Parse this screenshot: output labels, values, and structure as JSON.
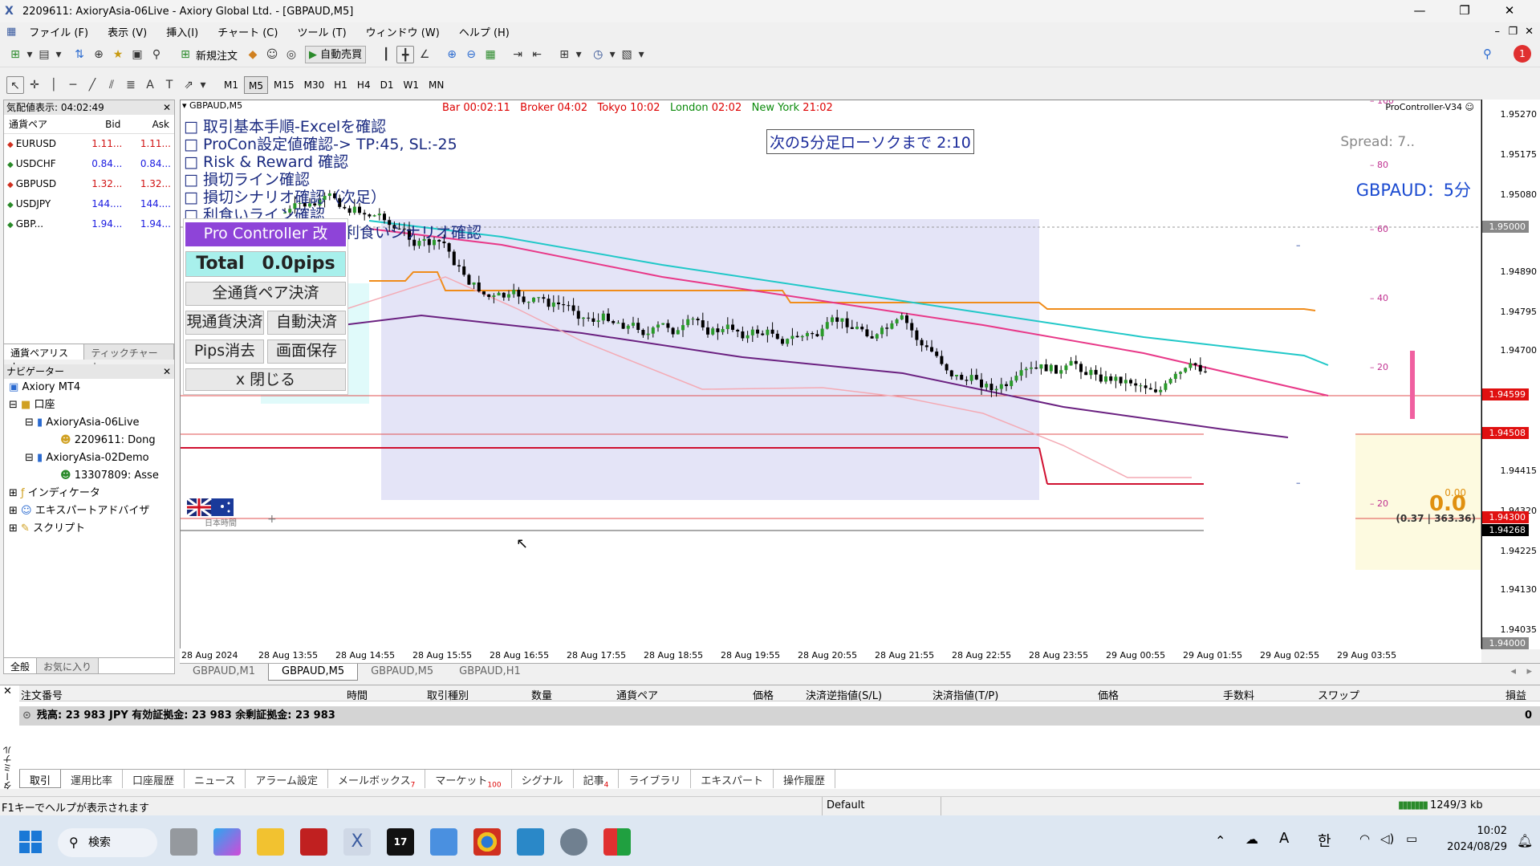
{
  "window": {
    "title": "2209611: AxioryAsia-06Live - Axiory Global Ltd. - [GBPAUD,M5]",
    "icon": "app-icon"
  },
  "menu": [
    "ファイル (F)",
    "表示 (V)",
    "挿入(I)",
    "チャート (C)",
    "ツール (T)",
    "ウィンドウ (W)",
    "ヘルプ (H)"
  ],
  "toolbar": {
    "new_order": "新規注文",
    "auto_trade": "自動売買",
    "timeframes": [
      "M1",
      "M5",
      "M15",
      "M30",
      "H1",
      "H4",
      "D1",
      "W1",
      "MN"
    ],
    "active_tf": "M5"
  },
  "market_watch": {
    "header": "気配値表示: 04:02:49",
    "columns": [
      "通貨ペア",
      "Bid",
      "Ask"
    ],
    "rows": [
      {
        "symbol": "EURUSD",
        "bid": "1.11...",
        "ask": "1.11...",
        "dir": "down"
      },
      {
        "symbol": "USDCHF",
        "bid": "0.84...",
        "ask": "0.84...",
        "dir": "up"
      },
      {
        "symbol": "GBPUSD",
        "bid": "1.32...",
        "ask": "1.32...",
        "dir": "down"
      },
      {
        "symbol": "USDJPY",
        "bid": "144....",
        "ask": "144....",
        "dir": "up"
      },
      {
        "symbol": "GBP...",
        "bid": "1.94...",
        "ask": "1.94...",
        "dir": "up"
      }
    ],
    "tabs": [
      "通貨ペアリスト",
      "ティックチャート"
    ]
  },
  "navigator": {
    "header": "ナビゲーター",
    "items": [
      "Axiory MT4",
      "口座",
      "AxioryAsia-06Live",
      "2209611: Dong",
      "AxioryAsia-02Demo",
      "13307809: Asse",
      "インディケータ",
      "エキスパートアドバイザ",
      "スクリプト"
    ],
    "tabs": [
      "全般",
      "お気に入り"
    ]
  },
  "chart": {
    "symbol_label": "GBPAUD,M5",
    "bar": "Bar",
    "bar_time": "00:02:11",
    "broker": "Broker",
    "broker_time": "04:02",
    "tokyo": "Tokyo",
    "tokyo_time": "10:02",
    "london": "London",
    "london_time": "02:02",
    "newyork": "New York",
    "newyork_time": "21:02",
    "checklist": [
      "□ 取引基本手順-Excelを確認",
      "□ ProCon設定値確認-> TP:45, SL:-25",
      "□ Risk & Reward 確認",
      "□ 損切ライン確認",
      "□ 損切シナリオ確認（次足）",
      "□ 利食いライン確認",
      "□ 利食いシナリオ確認"
    ],
    "countdown": "次の5分足ローソクまで 2:10",
    "indicator": "ProController-V34 ☺",
    "spread": "Spread: 7..",
    "pair_tf": "GBPAUD：5分",
    "scale_levels": [
      "100",
      "80",
      "60",
      "40",
      "20",
      "20"
    ],
    "profit": "0.0",
    "profit_small": "0.00",
    "ratio": "(0.37 | 363.36)",
    "flag_label": "日本時間"
  },
  "procon": {
    "title": "Pro Controller 改",
    "total": "Total　0.0pips",
    "close_all": "全通貨ペア決済",
    "close_current": "現通貨決済",
    "auto_close": "自動決済",
    "clear_pips": "Pips消去",
    "save_screen": "画面保存",
    "close": "x 閉じる"
  },
  "price_axis": {
    "labels": [
      "1.95270",
      "1.95175",
      "1.95080",
      "1.94890",
      "1.94795",
      "1.94700",
      "1.94415",
      "1.94320",
      "1.94225",
      "1.94130",
      "1.94035"
    ],
    "tags": [
      {
        "v": "1.95000",
        "c": "#777777"
      },
      {
        "v": "1.94599",
        "c": "#e01010"
      },
      {
        "v": "1.94508",
        "c": "#e01010"
      },
      {
        "v": "1.94300",
        "c": "#e01010"
      },
      {
        "v": "1.94268",
        "c": "#000000"
      },
      {
        "v": "1.94000",
        "c": "#777777"
      }
    ]
  },
  "time_axis": [
    "28 Aug 2024",
    "28 Aug 13:55",
    "28 Aug 14:55",
    "28 Aug 15:55",
    "28 Aug 16:55",
    "28 Aug 17:55",
    "28 Aug 18:55",
    "28 Aug 19:55",
    "28 Aug 20:55",
    "28 Aug 21:55",
    "28 Aug 22:55",
    "28 Aug 23:55",
    "29 Aug 00:55",
    "29 Aug 01:55",
    "29 Aug 02:55",
    "29 Aug 03:55"
  ],
  "chart_tabs": [
    "GBPAUD,M1",
    "GBPAUD,M5",
    "GBPAUD,M5",
    "GBPAUD,H1"
  ],
  "terminal": {
    "columns": [
      "注文番号",
      "時間",
      "取引種別",
      "数量",
      "通貨ペア",
      "価格",
      "決済逆指値(S/L)",
      "決済指値(T/P)",
      "価格",
      "手数料",
      "スワップ",
      "損益"
    ],
    "balance": "残高: 23 983 JPY  有効証拠金: 23 983  余剰証拠金: 23 983",
    "balance_pl": "0",
    "tabs": [
      "取引",
      "運用比率",
      "口座履歴",
      "ニュース",
      "アラーム設定",
      "メールボックス",
      "マーケット",
      "シグナル",
      "記事",
      "ライブラリ",
      "エキスパート",
      "操作履歴"
    ],
    "mail_count": "7",
    "market_count": "100",
    "article_count": "4",
    "side_label": "ターミナル"
  },
  "status": {
    "help": "F1キーでヘルプが表示されます",
    "profile": "Default",
    "traffic": "1249/3 kb"
  },
  "taskbar": {
    "search": "検索",
    "time": "10:02",
    "date": "2024/08/29",
    "ime": "A",
    "lang": "한"
  },
  "colors": {
    "accent": "#2b7bd6",
    "procon_title": "#8e44d8",
    "highlight": "#e6e6f8"
  }
}
